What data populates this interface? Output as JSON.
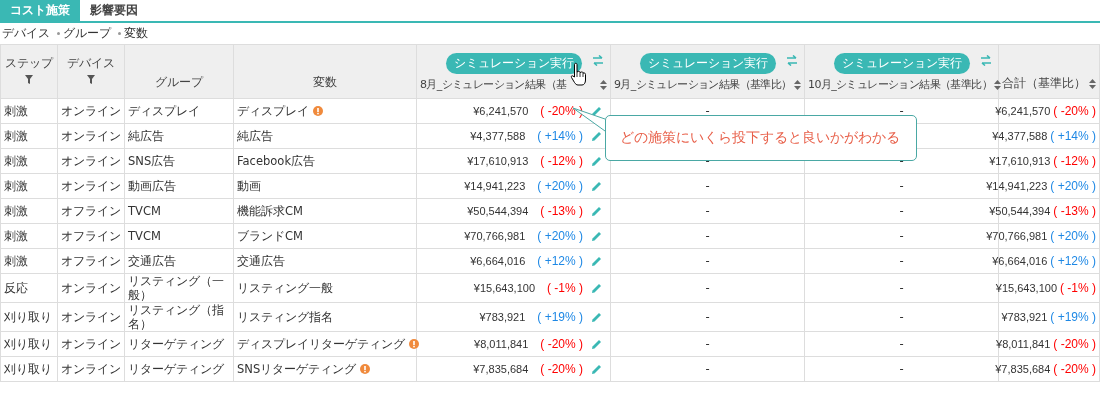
{
  "tabs": [
    {
      "label": "コスト施策",
      "selected": true
    },
    {
      "label": "影響要因",
      "selected": false
    }
  ],
  "breadcrumb": [
    "デバイス",
    "グループ",
    "変数"
  ],
  "table": {
    "columns": [
      {
        "label": "ステップ",
        "kind": "filter"
      },
      {
        "label": "デバイス",
        "kind": "filter"
      },
      {
        "label": "グループ",
        "kind": "plain"
      },
      {
        "label": "変数",
        "kind": "plain"
      },
      {
        "label": "8月_シミュレーション結果（基",
        "kind": "simulation",
        "button": "シミュレーション実行",
        "cursor": true
      },
      {
        "label": "9月_シミュレーション結果（基準比）",
        "kind": "simulation",
        "button": "シミュレーション実行"
      },
      {
        "label": "10月_シミュレーション結果（基準比）",
        "kind": "simulation",
        "button": "シミュレーション実行"
      },
      {
        "label": "合計（基準比）",
        "kind": "sort"
      }
    ],
    "rows": [
      {
        "step": "刺激",
        "device": "オンライン",
        "group": "ディスプレイ",
        "variable": "ディスプレイ",
        "warning": true,
        "amount": "¥6,241,570",
        "change": "( -20% )",
        "color": "#ff0000",
        "m9": "-",
        "m10": "-",
        "total": "¥6,241,570",
        "total_change": "( -20% )"
      },
      {
        "step": "刺激",
        "device": "オンライン",
        "group": "純広告",
        "variable": "純広告",
        "amount": "¥4,377,588",
        "change": "( +14% )",
        "color": "#1e88e5",
        "total": "¥4,377,588",
        "total_change": "( +14% )"
      },
      {
        "step": "刺激",
        "device": "オンライン",
        "group": "SNS広告",
        "variable": "Facebook広告",
        "amount": "¥17,610,913",
        "change": "( -12% )",
        "color": "#ff0000",
        "m9": "-",
        "m10": "-",
        "total": "¥17,610,913",
        "total_change": "( -12% )"
      },
      {
        "step": "刺激",
        "device": "オンライン",
        "group": "動画広告",
        "variable": "動画",
        "amount": "¥14,941,223",
        "change": "( +20% )",
        "color": "#1e88e5",
        "m9": "-",
        "m10": "-",
        "total": "¥14,941,223",
        "total_change": "( +20% )"
      },
      {
        "step": "刺激",
        "device": "オフライン",
        "group": "TVCM",
        "variable": "機能訴求CM",
        "amount": "¥50,544,394",
        "change": "( -13% )",
        "color": "#ff0000",
        "m9": "-",
        "m10": "-",
        "total": "¥50,544,394",
        "total_change": "( -13% )"
      },
      {
        "step": "刺激",
        "device": "オフライン",
        "group": "TVCM",
        "variable": "ブランドCM",
        "amount": "¥70,766,981",
        "change": "( +20% )",
        "color": "#1e88e5",
        "m9": "-",
        "m10": "-",
        "total": "¥70,766,981",
        "total_change": "( +20% )"
      },
      {
        "step": "刺激",
        "device": "オフライン",
        "group": "交通広告",
        "variable": "交通広告",
        "amount": "¥6,664,016",
        "change": "( +12% )",
        "color": "#1e88e5",
        "m9": "-",
        "m10": "-",
        "total": "¥6,664,016",
        "total_change": "( +12% )"
      },
      {
        "step": "反応",
        "device": "オンライン",
        "group": "リスティング（一般）",
        "variable": "リスティング一般",
        "amount": "¥15,643,100",
        "change": "( -1% )",
        "color": "#ff0000",
        "m9": "-",
        "m10": "-",
        "total": "¥15,643,100",
        "total_change": "( -1% )"
      },
      {
        "step": "刈り取り",
        "device": "オンライン",
        "group": "リスティング（指名）",
        "variable": "リスティング指名",
        "amount": "¥783,921",
        "change": "( +19% )",
        "color": "#1e88e5",
        "m9": "-",
        "m10": "-",
        "total": "¥783,921",
        "total_change": "( +19% )"
      },
      {
        "step": "刈り取り",
        "device": "オンライン",
        "group": "リターゲティング",
        "variable": "ディスプレイリターゲティング",
        "warning": true,
        "amount": "¥8,011,841",
        "change": "( -20% )",
        "color": "#ff0000",
        "m9": "-",
        "m10": "-",
        "total": "¥8,011,841",
        "total_change": "( -20% )"
      },
      {
        "step": "刈り取り",
        "device": "オンライン",
        "group": "リターゲティング",
        "variable": "SNSリターゲティング",
        "warning": true,
        "amount": "¥7,835,684",
        "change": "( -20% )",
        "color": "#ff0000",
        "m9": "-",
        "m10": "-",
        "total": "¥7,835,684",
        "total_change": "( -20% )"
      }
    ]
  },
  "callout": {
    "text": "どの施策にいくら投下すると良いかがわかる"
  }
}
